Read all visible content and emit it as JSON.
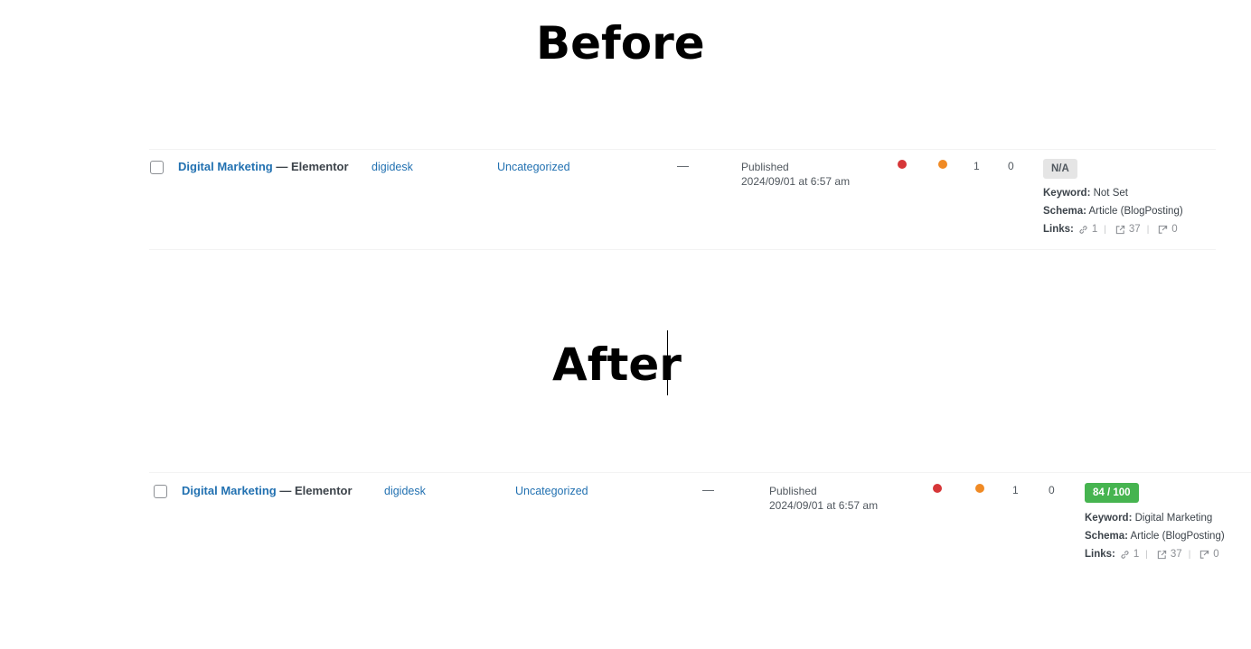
{
  "before": {
    "heading": "Before",
    "row": {
      "title_link": "Digital Marketing",
      "title_suffix": " — Elementor",
      "author": "digidesk",
      "category": "Uncategorized",
      "tags": "—",
      "status": "Published",
      "date": "2024/09/01 at 6:57 am",
      "count_1": "1",
      "count_2": "0",
      "seo_score": "N/A",
      "keyword_label": "Keyword:",
      "keyword_value": "Not Set",
      "schema_label": "Schema:",
      "schema_value": "Article (BlogPosting)",
      "links_label": "Links:",
      "links_internal": "1",
      "links_external": "37",
      "links_incoming": "0"
    }
  },
  "after": {
    "heading": "After",
    "row": {
      "title_link": "Digital Marketing",
      "title_suffix": " — Elementor",
      "author": "digidesk",
      "category": "Uncategorized",
      "tags": "—",
      "status": "Published",
      "date": "2024/09/01 at 6:57 am",
      "count_1": "1",
      "count_2": "0",
      "seo_score": "84 / 100",
      "keyword_label": "Keyword:",
      "keyword_value": "Digital Marketing",
      "schema_label": "Schema:",
      "schema_value": "Article (BlogPosting)",
      "links_label": "Links:",
      "links_internal": "1",
      "links_external": "37",
      "links_incoming": "0"
    }
  },
  "colors": {
    "link": "#2271b1",
    "dot_red": "#d63638",
    "dot_orange": "#f08a24",
    "badge_good": "#46b450",
    "badge_na": "#e5e5e5"
  },
  "icons": [
    "internal-link-icon",
    "external-link-icon",
    "incoming-link-icon"
  ]
}
